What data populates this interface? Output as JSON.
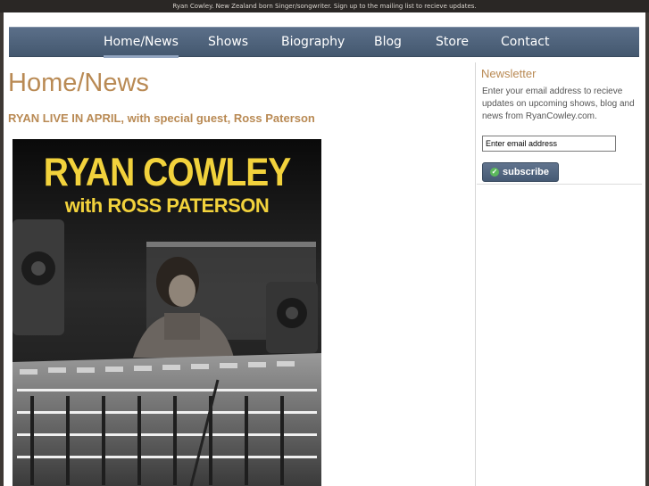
{
  "topbar": {
    "text": "Ryan Cowley. New Zealand born Singer/songwriter. Sign up to the mailing list to recieve updates."
  },
  "nav": {
    "items": [
      {
        "label": "Home/News",
        "active": true
      },
      {
        "label": "Shows",
        "active": false
      },
      {
        "label": "Biography",
        "active": false
      },
      {
        "label": "Blog",
        "active": false
      },
      {
        "label": "Store",
        "active": false
      },
      {
        "label": "Contact",
        "active": false
      }
    ]
  },
  "main": {
    "page_title": "Home/News",
    "post_title": "RYAN LIVE IN APRIL, with special guest, Ross Paterson",
    "poster": {
      "line1": "RYAN COWLEY",
      "line2": "with ROSS PATERSON"
    }
  },
  "sidebar": {
    "title": "Newsletter",
    "description": "Enter your email address to recieve updates on upcoming shows, blog and news from RyanCowley.com.",
    "email_value": "Enter email address",
    "subscribe_label": "subscribe"
  },
  "colors": {
    "accent": "#b98a54",
    "nav": "#51657e",
    "poster_text": "#f2d23c"
  }
}
